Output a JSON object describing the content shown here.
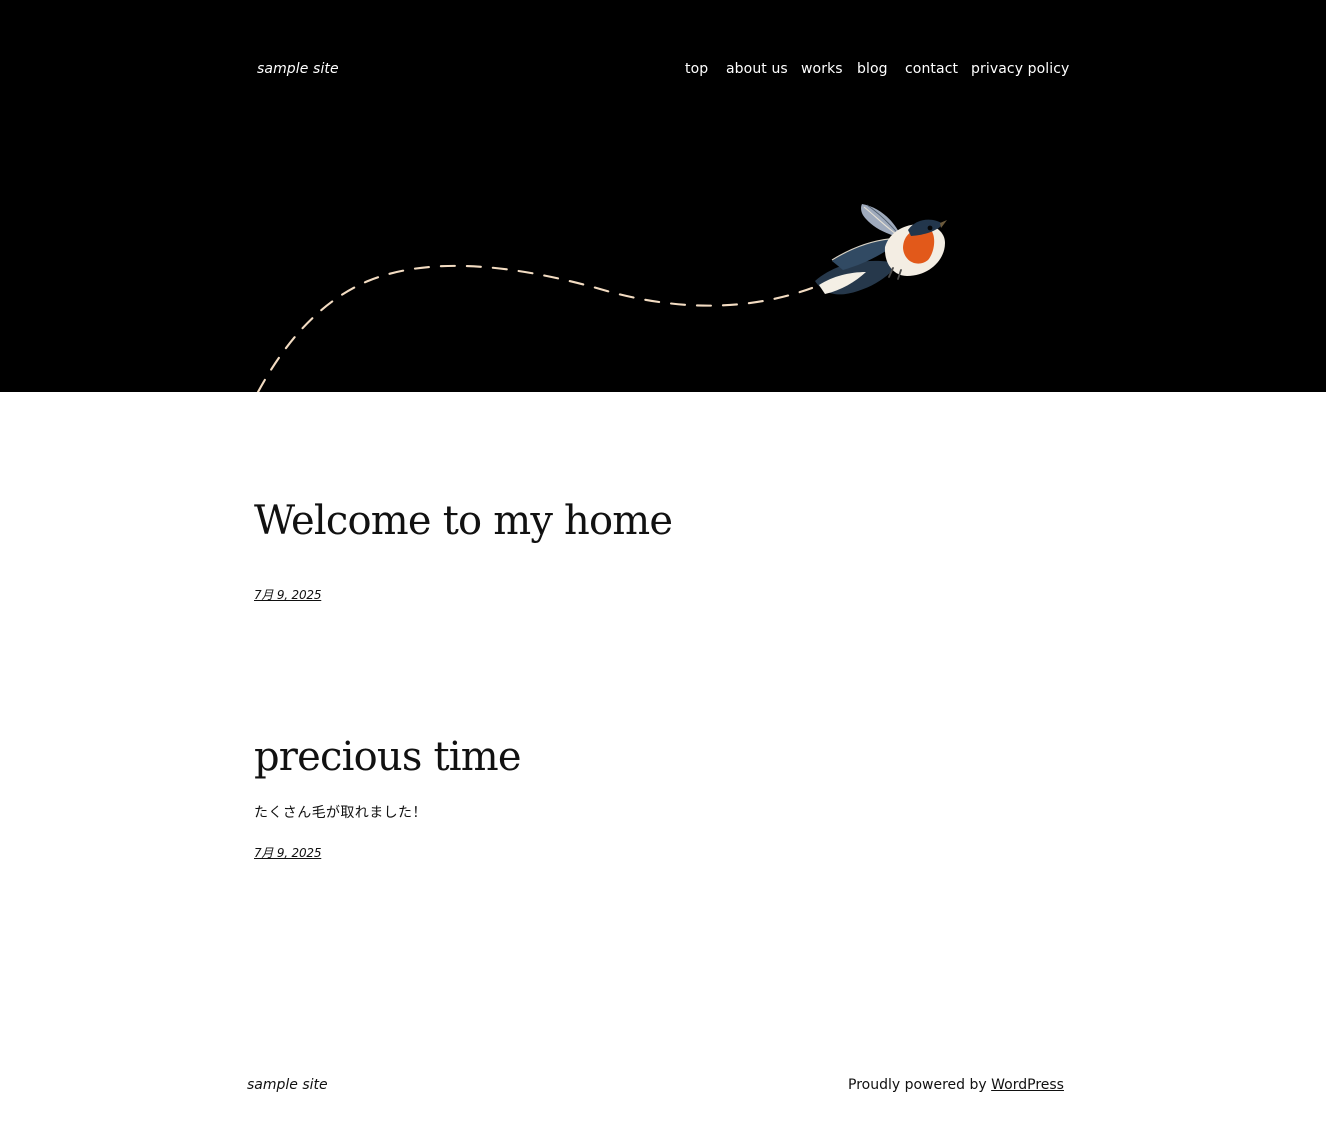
{
  "header": {
    "site_title": "sample site",
    "nav": [
      {
        "label": "top",
        "slug": "top"
      },
      {
        "label": "about us",
        "slug": "about-us"
      },
      {
        "label": "works",
        "slug": "works"
      },
      {
        "label": "blog",
        "slug": "blog"
      },
      {
        "label": "contact",
        "slug": "contact"
      },
      {
        "label": "privacy policy",
        "slug": "privacy-policy"
      }
    ],
    "hero_icon": "flying-bird-icon"
  },
  "posts": [
    {
      "title": "Welcome to my home",
      "excerpt": "",
      "date": "7月 9, 2025"
    },
    {
      "title": "precious time",
      "excerpt": "たくさん毛が取れました！",
      "date": "7月 9, 2025"
    }
  ],
  "footer": {
    "site_title": "sample site",
    "powered_prefix": "Proudly powered by ",
    "powered_link": "WordPress"
  },
  "colors": {
    "header_background": "#000000",
    "page_background": "#ffffff",
    "text": "#111111",
    "flight_path": "#f3dcc2",
    "bird_throat": "#e2591a"
  }
}
